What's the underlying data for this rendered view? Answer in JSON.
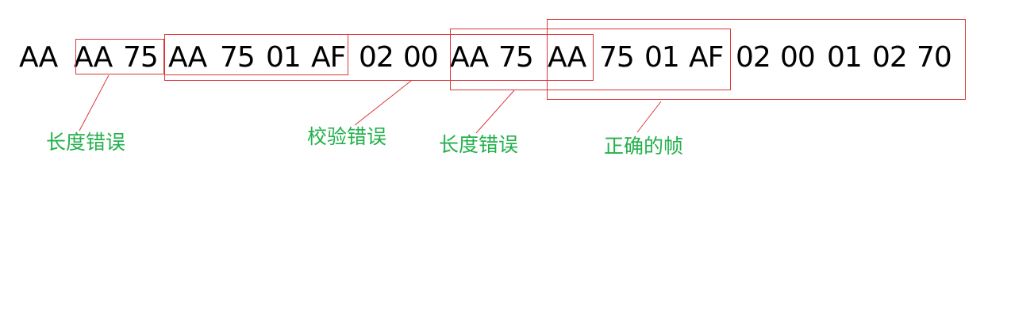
{
  "bytes": [
    "AA",
    "AA",
    "75",
    "AA",
    "75",
    "01",
    "AF",
    "02",
    "00",
    "AA",
    "75",
    "AA",
    "75",
    "01",
    "AF",
    "02",
    "00",
    "01",
    "02",
    "70"
  ],
  "annotations": [
    {
      "label": "长度错误"
    },
    {
      "label": "校验错误"
    },
    {
      "label": "长度错误"
    },
    {
      "label": "正确的帧"
    }
  ],
  "colors": {
    "text": "#000000",
    "box": "#d9383c",
    "label": "#22b14c"
  }
}
